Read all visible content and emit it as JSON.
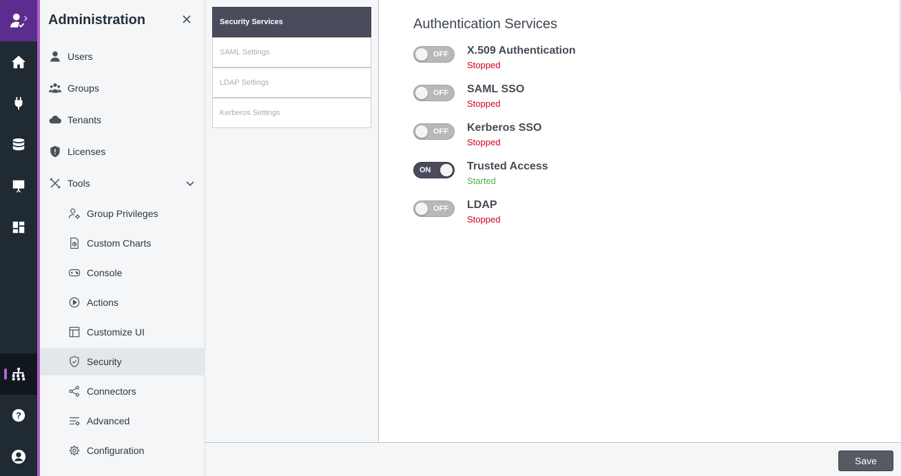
{
  "rail": {
    "items": [
      {
        "icon": "home-icon"
      },
      {
        "icon": "plug-icon"
      },
      {
        "icon": "database-icon"
      },
      {
        "icon": "presentation-icon"
      },
      {
        "icon": "dashboard-icon"
      },
      {
        "icon": "sitemap-icon",
        "active": true
      },
      {
        "icon": "help-icon"
      },
      {
        "icon": "account-icon"
      }
    ],
    "accent_color": "#5b2d8e"
  },
  "admin": {
    "title": "Administration",
    "items": [
      {
        "label": "Users",
        "icon": "user-icon"
      },
      {
        "label": "Groups",
        "icon": "groups-icon"
      },
      {
        "label": "Tenants",
        "icon": "cloud-icon"
      },
      {
        "label": "Licenses",
        "icon": "shield-icon"
      },
      {
        "label": "Tools",
        "icon": "tools-icon",
        "expanded": true
      }
    ],
    "tools": [
      {
        "label": "Group Privileges",
        "icon": "user-gear-icon"
      },
      {
        "label": "Custom Charts",
        "icon": "chart-doc-icon"
      },
      {
        "label": "Console",
        "icon": "gamepad-icon"
      },
      {
        "label": "Actions",
        "icon": "play-circle-icon"
      },
      {
        "label": "Customize UI",
        "icon": "layout-icon"
      },
      {
        "label": "Security",
        "icon": "shield-check-icon",
        "selected": true
      },
      {
        "label": "Connectors",
        "icon": "share-icon"
      },
      {
        "label": "Advanced",
        "icon": "sliders-icon"
      },
      {
        "label": "Configuration",
        "icon": "gear-icon"
      }
    ]
  },
  "subtabs": [
    {
      "label": "Security Services",
      "active": true
    },
    {
      "label": "SAML Settings"
    },
    {
      "label": "LDAP Settings"
    },
    {
      "label": "Kerberos Settings"
    }
  ],
  "main": {
    "title": "Authentication Services",
    "services": [
      {
        "name": "X.509 Authentication",
        "toggle": "OFF",
        "status": "Stopped"
      },
      {
        "name": "SAML SSO",
        "toggle": "OFF",
        "status": "Stopped"
      },
      {
        "name": "Kerberos SSO",
        "toggle": "OFF",
        "status": "Stopped"
      },
      {
        "name": "Trusted Access",
        "toggle": "ON",
        "status": "Started"
      },
      {
        "name": "LDAP",
        "toggle": "OFF",
        "status": "Stopped"
      }
    ]
  },
  "footer": {
    "save_label": "Save"
  },
  "colors": {
    "stopped": "#d0021b",
    "started": "#4caf50",
    "toggle_on": "#4a4b5c",
    "toggle_off": "#b8b8b8"
  }
}
